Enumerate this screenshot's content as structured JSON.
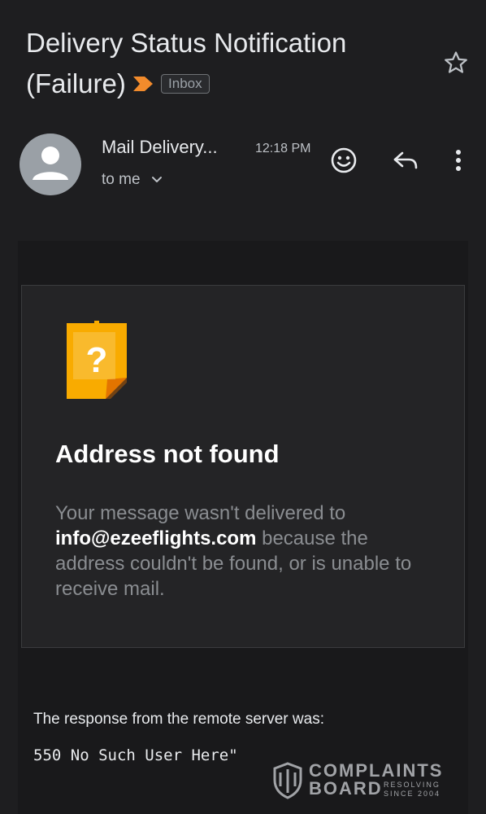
{
  "email": {
    "subject_line1": "Delivery Status Notification",
    "subject_line2": "(Failure)",
    "label": "Inbox",
    "sender": "Mail Delivery...",
    "time": "12:18 PM",
    "recipient": "to me"
  },
  "icons": {
    "star": "star-icon",
    "importance": "importance-marker-icon",
    "avatar": "person-icon",
    "emoji": "smiley-icon",
    "reply": "reply-icon",
    "more": "more-vert-icon",
    "chevron": "chevron-down-icon",
    "note": "question-note-icon"
  },
  "bounce": {
    "title": "Address not found",
    "body_before": "Your message wasn't delivered to",
    "address": "info@ezeeflights.com",
    "body_after": "because the address couldn't be found, or is unable to receive mail.",
    "response_label": "The response from the remote server was:",
    "response_code": "550 No Such User Here\""
  },
  "watermark": {
    "line1": "COMPLAINTS",
    "line2": "BOARD",
    "sub1": "RESOLVING",
    "sub2": "SINCE 2004"
  },
  "colors": {
    "background": "#1e1e20",
    "card": "#242426",
    "importance": "#f28b2c",
    "note": "#f9ab00"
  }
}
